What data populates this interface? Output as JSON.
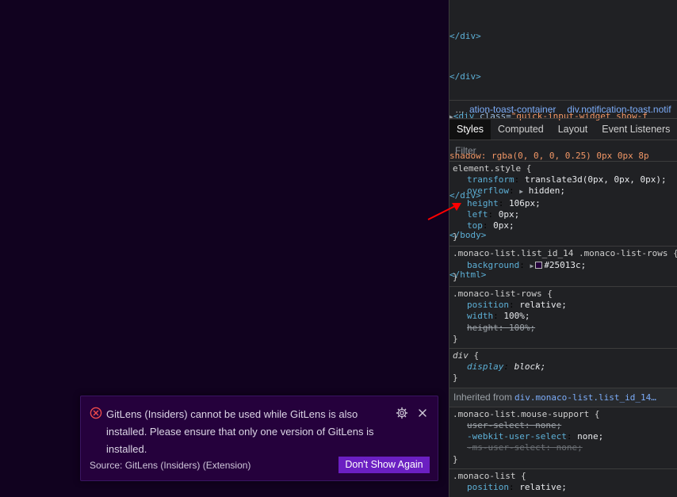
{
  "toast": {
    "message": "GitLens (Insiders) cannot be used while GitLens is also installed. Please ensure that only one version of GitLens is installed.",
    "source": "Source: GitLens (Insiders) (Extension)",
    "button_label": "Don't Show Again",
    "icons": {
      "error": "error-circle-icon",
      "settings": "gear-icon",
      "close": "close-icon"
    },
    "colors": {
      "background": "#25013c",
      "button": "#6b1fc2",
      "error": "#f14c4c"
    }
  },
  "devtools": {
    "dom_lines": [
      {
        "indent": "          ",
        "tag_close": "</div>"
      },
      {
        "indent": "        ",
        "tag_close": "</div>"
      },
      {
        "indent": "       ",
        "triangle": "▶",
        "tag_open": "<div",
        "attr": " class=",
        "val": "\"quick-input-widget show-f"
      },
      {
        "indent": "       ",
        "text": "shadow: rgba(0, 0, 0, 0.25) 0px 0px 8p"
      },
      {
        "indent": "       ",
        "tag_close": "</div>"
      },
      {
        "indent": "     ",
        "tag_close": "</body>"
      },
      {
        "indent": "   ",
        "tag_close": "</html>"
      }
    ],
    "breadcrumbs": {
      "dots": "…",
      "items": [
        "ation-toast-container",
        "div.notification-toast.notif"
      ]
    },
    "tabs": [
      "Styles",
      "Computed",
      "Layout",
      "Event Listeners"
    ],
    "active_tab": "Styles",
    "filter_placeholder": "Filter",
    "rules": [
      {
        "selector": "element.style",
        "props": [
          {
            "name": "transform",
            "value": "translate3d(0px, 0px, 0px);"
          },
          {
            "name": "overflow",
            "value": "hidden;",
            "expandable": true
          },
          {
            "name": "height",
            "value": "106px;"
          },
          {
            "name": "left",
            "value": "0px;"
          },
          {
            "name": "top",
            "value": "0px;"
          }
        ]
      },
      {
        "selector": ".monaco-list.list_id_14 .monaco-list-rows",
        "props": [
          {
            "name": "background",
            "value": "#25013c;",
            "expandable": true,
            "swatch": "#25013c"
          }
        ]
      },
      {
        "selector": ".monaco-list-rows",
        "props": [
          {
            "name": "position",
            "value": "relative;"
          },
          {
            "name": "width",
            "value": "100%;"
          },
          {
            "name": "height",
            "value": "100%;",
            "struck": true
          }
        ]
      },
      {
        "selector": "div",
        "italic": true,
        "props": [
          {
            "name": "display",
            "value": "block;"
          }
        ]
      }
    ],
    "inherited_label": "Inherited from",
    "inherited_link": "div.monaco-list.list_id_14…",
    "inherited_rules": [
      {
        "selector": ".monaco-list.mouse-support",
        "props": [
          {
            "name": "user-select",
            "value": "none;",
            "struck": true
          },
          {
            "name": "-webkit-user-select",
            "value": "none;"
          },
          {
            "name": "-ms-user-select",
            "value": "none;",
            "struck": true,
            "faded": true
          }
        ]
      },
      {
        "selector": ".monaco-list",
        "props": [
          {
            "name": "position",
            "value": "relative;"
          }
        ]
      }
    ],
    "colors": {
      "panel": "#202124",
      "tag": "#5db0d7",
      "attr_value": "#f29766",
      "link": "#7cacf8"
    }
  },
  "annotation": {
    "type": "red-arrow-icon",
    "color": "#ff0000"
  }
}
